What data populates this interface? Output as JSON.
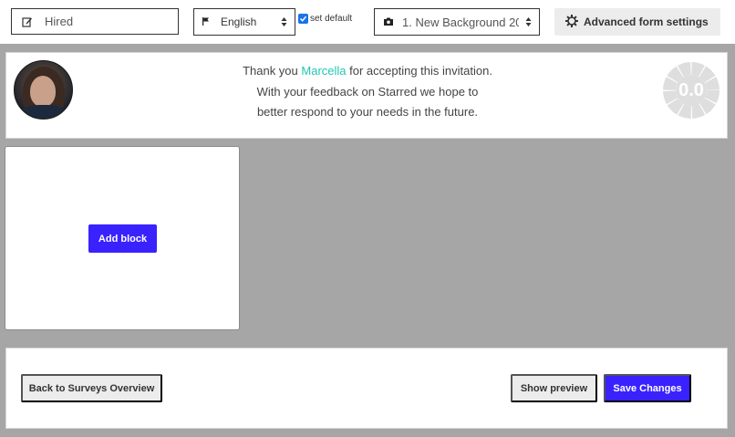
{
  "toolbar": {
    "title_value": "Hired",
    "language": {
      "selected": "English",
      "icon": "flag-icon"
    },
    "set_default": {
      "label": "set default",
      "checked": true
    },
    "background": {
      "selected": "1. New Background 20",
      "icon": "camera-icon"
    },
    "advanced": {
      "label": "Advanced form settings",
      "icon": "gear-icon"
    }
  },
  "header": {
    "line1_before": "Thank you ",
    "name": "Marcella",
    "line1_after": " for accepting this invitation.",
    "line2": "With your feedback on Starred we hope to",
    "line3": "better respond to your needs in the future.",
    "score": "0.0"
  },
  "block": {
    "add_label": "Add block"
  },
  "footer": {
    "back_label": "Back to Surveys Overview",
    "preview_label": "Show preview",
    "save_label": "Save Changes"
  },
  "colors": {
    "accent": "#3a22ff",
    "highlight": "#1ec8b2",
    "background": "#a6a6a6"
  }
}
